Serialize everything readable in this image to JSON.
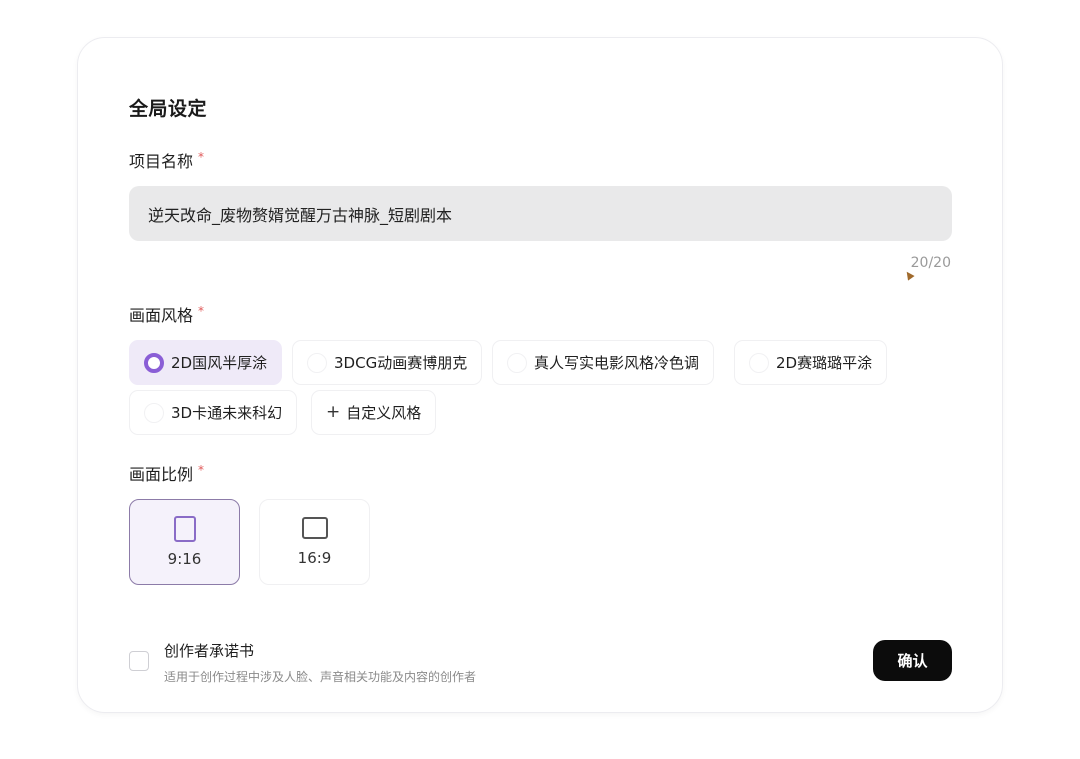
{
  "settings": {
    "title": "全局设定",
    "project_name": {
      "label": "项目名称",
      "required_mark": "*",
      "value": "逆天改命_废物赘婿觉醒万古神脉_短剧剧本",
      "char_count": "20/20"
    },
    "visual_style": {
      "label": "画面风格",
      "required_mark": "*",
      "options": [
        {
          "label": "2D国风半厚涂",
          "selected": true
        },
        {
          "label": "3DCG动画赛博朋克",
          "selected": false
        },
        {
          "label": "真人写实电影风格冷色调",
          "selected": false
        },
        {
          "label": "2D赛璐璐平涂",
          "selected": false
        },
        {
          "label": "3D卡通未来科幻",
          "selected": false
        }
      ],
      "custom_label": "自定义风格",
      "custom_icon": "plus-icon"
    },
    "aspect_ratio": {
      "label": "画面比例",
      "required_mark": "*",
      "options": [
        {
          "label": "9:16",
          "selected": true,
          "icon": "portrait-frame-icon"
        },
        {
          "label": "16:9",
          "selected": false,
          "icon": "square-frame-icon"
        }
      ]
    },
    "pledge": {
      "title": "创作者承诺书",
      "description": "适用于创作过程中涉及人脸、声音相关功能及内容的创作者",
      "checked": false
    },
    "confirm_label": "确认"
  },
  "colors": {
    "accent": "#8a5ed6",
    "selected_chip_bg": "#efeaf8",
    "required_mark": "#e05a5a",
    "primary_button": "#0c0c0c",
    "input_bg": "#e9e9ea"
  }
}
